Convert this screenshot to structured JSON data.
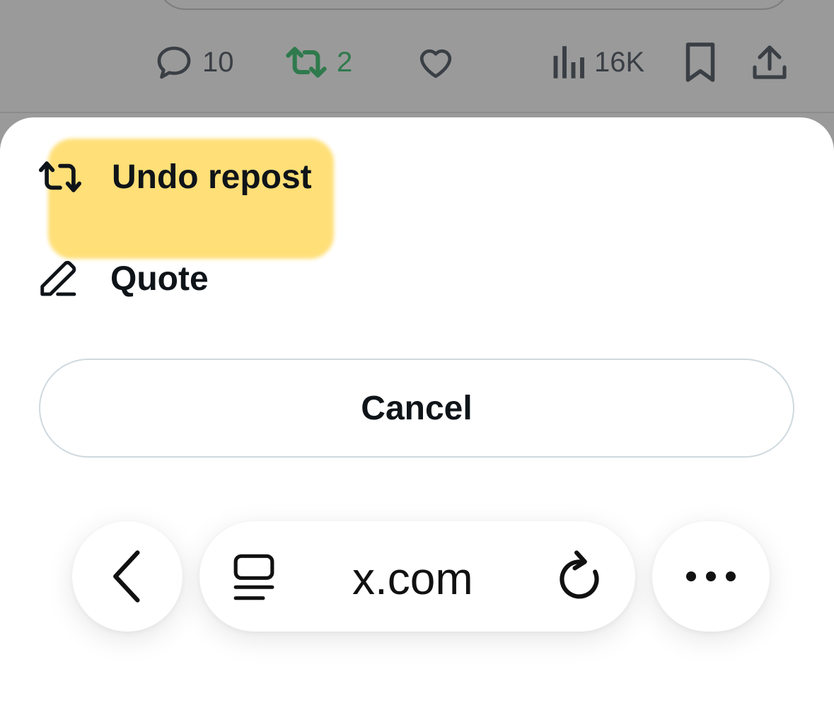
{
  "tweet_actions": {
    "reply_count": "10",
    "repost_count": "2",
    "views_count": "16K"
  },
  "sheet": {
    "undo_repost_label": "Undo repost",
    "quote_label": "Quote",
    "cancel_label": "Cancel"
  },
  "browser": {
    "url": "x.com"
  },
  "colors": {
    "highlight": "#ffde73",
    "repost_active": "#2f7a4d",
    "text": "#0f1419"
  },
  "icons": [
    "reply-icon",
    "repost-icon",
    "like-icon",
    "views-icon",
    "bookmark-icon",
    "share-icon",
    "repost-icon",
    "quote-pencil-icon",
    "back-chevron-icon",
    "reader-mode-icon",
    "reload-icon",
    "more-icon"
  ]
}
